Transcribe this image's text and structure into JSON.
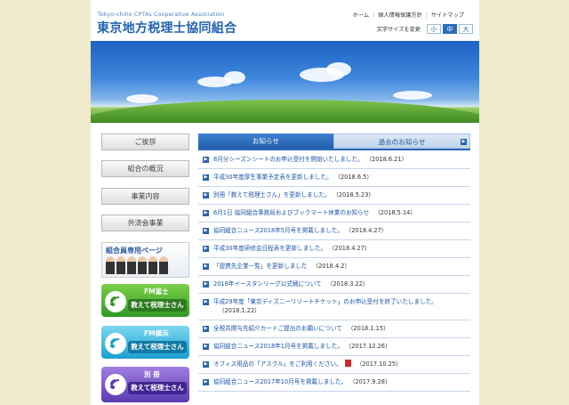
{
  "header": {
    "logo_en": "Tokyo-chiho CPTAs Cooperative Association",
    "logo_ja": "東京地方税理士協同組合",
    "links": [
      "ホーム",
      "個人情報保護方針",
      "サイトマップ"
    ],
    "font_size_label": "文字サイズを変更",
    "font_sizes": [
      "小",
      "中",
      "大"
    ],
    "font_size_selected": "中"
  },
  "sidebar": {
    "items": [
      "ご挨拶",
      "組合の概況",
      "事業内容",
      "共済会事業"
    ],
    "member_banner": "組合員専用ページ",
    "banners": [
      {
        "top": "FM富士",
        "main": "教えて税理士さん"
      },
      {
        "top": "FM横浜",
        "main": "教えて税理士さん"
      },
      {
        "top": "別 冊",
        "main": "教えて税理士さん"
      }
    ]
  },
  "tabs": {
    "active": "お知らせ",
    "inactive": "過去のお知らせ"
  },
  "news": [
    {
      "text": "8月分シーズンシートのお申込受付を開始いたしました。",
      "date": "（2018.6.21）"
    },
    {
      "text": "平成30年度厚生事業予定表を更新しました。",
      "date": "（2018.6.5）"
    },
    {
      "text": "別冊「教えて税理士さん」を更新しました。",
      "date": "（2018.5.23）"
    },
    {
      "text": "6月1日 協同組合事務局およびブックマート休業のお知らせ",
      "date": "（2018.5.14）"
    },
    {
      "text": "協同組合ニュース2018年5月号を掲載しました。",
      "date": "（2018.4.27）"
    },
    {
      "text": "平成30年度研修会日程表を更新しました。",
      "date": "（2018.4.27）"
    },
    {
      "text": "「提携先企業一覧」を更新しました",
      "date": "（2018.4.2）"
    },
    {
      "text": "2018年イースタンリーグ公式戦について",
      "date": "（2018.3.22）"
    },
    {
      "text": "平成29年度「東京ディズニーリゾートチケット」のお申込受付を終了いたしました。",
      "date": "（2018.1.22）"
    },
    {
      "text": "全税共開与先紹介カードご提出のお願いについて",
      "date": "（2018.1.15）"
    },
    {
      "text": "協同組合ニュース2018年1月号を掲載しました。",
      "date": "（2017.12.26）"
    },
    {
      "text": "オフィス用品の「アスクル」をご利用ください。",
      "date": "（2017.10.25）"
    },
    {
      "text": "協同組合ニュース2017年10月号を掲載しました。",
      "date": "（2017.9.28）"
    }
  ],
  "colors": {
    "background": "#efeacb",
    "brand_blue": "#2163b3",
    "tab_active": "#2c6cb8",
    "link": "#1c55a8"
  },
  "icons": {
    "bullet": "arrow-right-square-icon",
    "pdf": "pdf-icon",
    "radio": "radio-wave-icon"
  }
}
